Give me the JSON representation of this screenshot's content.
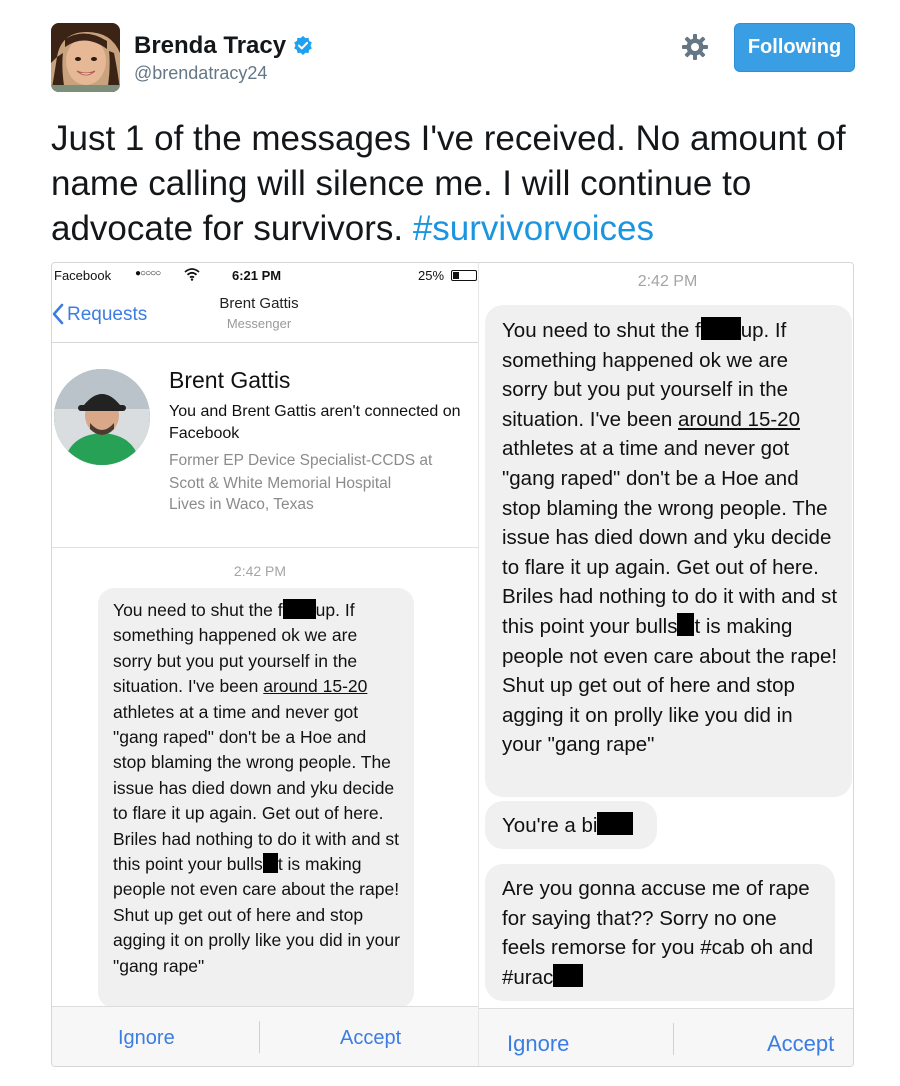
{
  "tweet": {
    "display_name": "Brenda Tracy",
    "handle": "@brendatracy24",
    "follow_label": "Following",
    "text": "Just 1 of the messages I've received. No amount of name calling will silence me. I will continue to advocate for survivors.",
    "hashtag": "#survivorvoices"
  },
  "left_screenshot": {
    "status_bar": {
      "carrier": "Facebook",
      "signal": "●○○○○",
      "time": "6:21 PM",
      "battery": "25%"
    },
    "nav": {
      "back_label": "Requests",
      "title": "Brent Gattis",
      "subtitle": "Messenger"
    },
    "profile": {
      "name": "Brent Gattis",
      "connection": "You and Brent Gattis aren't connected on Facebook",
      "detail": "Former EP Device Specialist-CCDS at Scott & White Memorial Hospital",
      "lives": "Lives in Waco, Texas"
    },
    "thread_time": "2:42 PM",
    "message": {
      "p1": "You need to shut the f",
      "p2": "up. If something happened ok we are sorry but you put yourself in the situation. I've been ",
      "underlined": "around 15-20",
      "p3": " athletes at a time and never got \"gang raped\" don't be a Hoe and stop blaming the wrong people. The issue has died down and yku decide to flare it up again. Get out of here. Briles had nothing to do it with and st this point your bulls",
      "p4": "t is making people not even care about the rape! Shut up get out of here and stop agging it on prolly like you did in your \"gang rape\""
    },
    "actions": {
      "ignore": "Ignore",
      "accept": "Accept"
    }
  },
  "right_screenshot": {
    "thread_time": "2:42 PM",
    "message1": {
      "p1": "You need to shut the f",
      "p2": "up. If something happened ok we are sorry but you put yourself in the situation. I've been ",
      "underlined": "around 15-20",
      "p3": " athletes at a time and never got \"gang raped\" don't be a Hoe and stop blaming the wrong people. The issue has died down and yku decide to flare it up again. Get out of here. Briles had nothing to do it with and st this point your bulls",
      "p4": "t is making people not even care about the rape! Shut up get out of here and stop agging it on prolly like you did in your \"gang rape\""
    },
    "message2": {
      "text": "You're a bi"
    },
    "message3": {
      "text": "Are you gonna accuse me of rape for saying that?? Sorry no one feels remorse for you #cab oh and #urac"
    },
    "actions": {
      "ignore": "Ignore",
      "accept": "Accept"
    }
  },
  "colors": {
    "link_blue": "#1b95e0",
    "follow_button": "#3a9ee4",
    "ios_blue": "#3b7de2",
    "bubble_gray": "#f0f0f0",
    "verified_blue": "#1da1f2"
  },
  "icons": [
    "verified-badge-icon",
    "gear-icon",
    "wifi-icon",
    "battery-icon",
    "back-chevron-icon"
  ]
}
